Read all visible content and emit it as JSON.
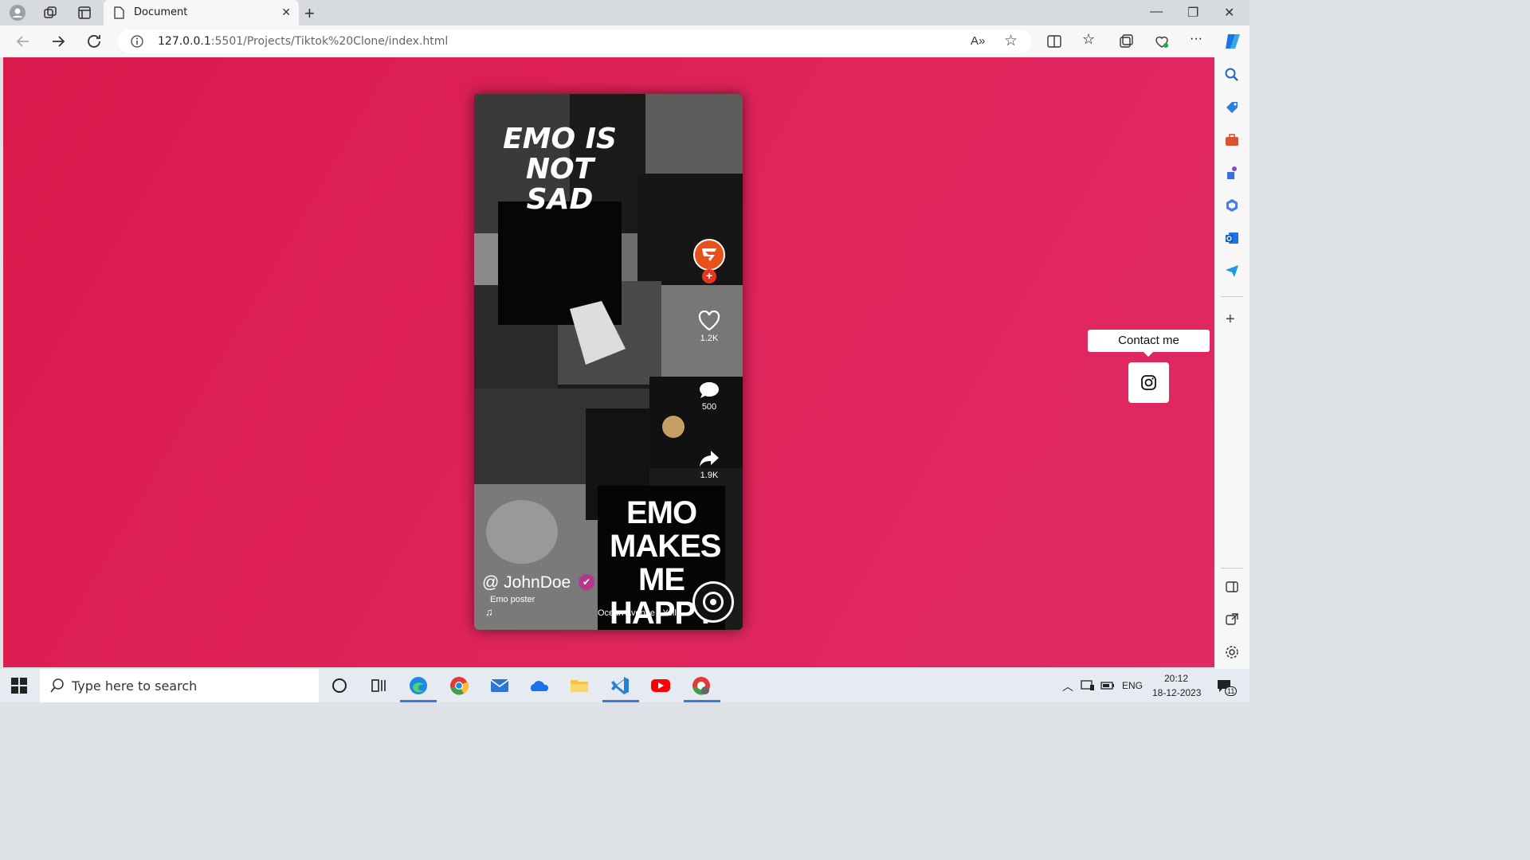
{
  "browser": {
    "tab_title": "Document",
    "url_host": "127.0.0.1",
    "url_rest": ":5501/Projects/Tiktok%20Clone/index.html"
  },
  "post": {
    "collage_text_1": "EMO IS NOT SAD",
    "collage_text_2": "EMO MAKES ME HAPPY",
    "likes": "1.2K",
    "comments": "500",
    "shares": "1.9K",
    "username": "@ JohnDoe",
    "description": "Emo poster",
    "song": "Ocean Avenue - Yellow"
  },
  "contact": {
    "label": "Contact me"
  },
  "taskbar": {
    "search_placeholder": "Type here to search",
    "language": "ENG",
    "time": "20:12",
    "date": "18-12-2023",
    "notifications": "11"
  },
  "colors": {
    "page_bg": "#df2259",
    "verified": "#b3388c",
    "follow_badge": "#e8361e"
  },
  "icons": [
    "profile-icon",
    "workspaces-icon",
    "tab-actions-icon",
    "page-icon",
    "close-icon",
    "new-tab-icon",
    "back-icon",
    "forward-icon",
    "refresh-icon",
    "info-icon",
    "read-aloud-icon",
    "favorite-star-icon",
    "split-screen-icon",
    "favorites-icon",
    "collections-icon",
    "health-icon",
    "more-icon",
    "copilot-icon",
    "heart-icon",
    "comment-icon",
    "share-icon",
    "music-note-icon",
    "verified-icon",
    "instagram-icon",
    "windows-start-icon",
    "search-icon"
  ]
}
